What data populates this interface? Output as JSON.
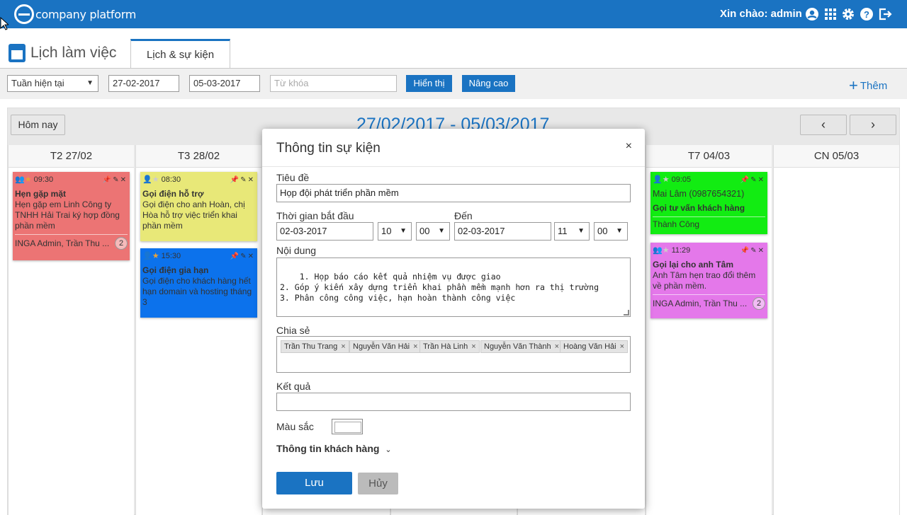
{
  "header": {
    "brand": "company platform",
    "greeting": "Xin chào: admin"
  },
  "page": {
    "title": "Lịch làm việc",
    "tab": "Lịch & sự kiện"
  },
  "filter": {
    "period": "Tuần hiện tại",
    "from": "27-02-2017",
    "to": "05-03-2017",
    "keyword_placeholder": "Từ khóa",
    "show_label": "Hiển thị",
    "advanced_label": "Nâng cao",
    "add_label": "Thêm"
  },
  "calendar": {
    "today_label": "Hôm nay",
    "range": "27/02/2017 - 05/03/2017",
    "prev": "‹",
    "next": "›",
    "days": [
      "T2 27/02",
      "T3 28/02",
      "T7 04/03",
      "CN 05/03"
    ],
    "events": [
      {
        "time": "09:30",
        "title": "Hẹn gặp mặt",
        "body": "Hẹn gặp em Linh Công ty TNHH Hải Trai ký hợp đồng phần mềm",
        "people": "INGA Admin, Trần Thu ...",
        "count": "2",
        "color": "#ec7474"
      },
      {
        "time": "08:30",
        "title": "Gọi điện hỗ trợ",
        "body": "Gọi điện cho anh Hoàn, chị Hòa hỗ trợ việc triển khai phần mềm",
        "color": "#e8e878"
      },
      {
        "time": "15:30",
        "title": "Gọi điện gia hạn",
        "body": "Gọi điện cho khách hàng hết hạn domain và hosting tháng 3",
        "color": "#0c72ec"
      },
      {
        "time": "09:05",
        "contact": "Mai Lâm (0987654321)",
        "title": "Gọi tư vấn khách hàng",
        "status": "Thành Công",
        "color": "#12ec12"
      },
      {
        "time": "11:29",
        "title": "Gọi lại cho anh Tâm",
        "body": "Anh Tâm hẹn trao đổi thêm về phần mềm.",
        "people": "INGA Admin, Trần Thu ...",
        "count": "2",
        "color": "#e478ea"
      }
    ]
  },
  "modal": {
    "title": "Thông tin sự kiện",
    "close": "×",
    "title_label": "Tiêu đề",
    "title_value": "Họp đội phát triển phần mềm",
    "start_label": "Thời gian bắt đầu",
    "start_date": "02-03-2017",
    "start_hour": "10",
    "start_min": "00",
    "end_label": "Đến",
    "end_date": "02-03-2017",
    "end_hour": "11",
    "end_min": "00",
    "content_label": "Nội dung",
    "content": "1. Họp báo cáo kết quả nhiệm vụ được giao\n2. Góp ý kiến xây dựng triển khai phần mềm mạnh hơn ra thị trường\n3. Phân công công việc, hạn hoàn thành công việc",
    "share_label": "Chia sẻ",
    "share_tags": [
      "Trần Thu Trang",
      "Nguyễn Văn Hải",
      "Trần Hà Linh",
      "Nguyễn Văn Thành",
      "Hoàng Văn Hải"
    ],
    "result_label": "Kết quả",
    "result_value": "",
    "color_label": "Màu sắc",
    "customer_label": "Thông tin khách hàng",
    "save_label": "Lưu",
    "cancel_label": "Hủy"
  }
}
